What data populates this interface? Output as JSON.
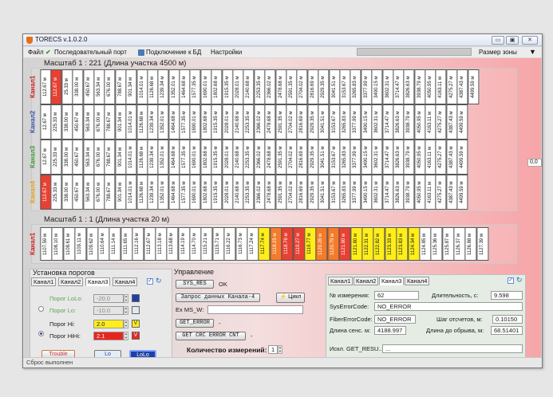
{
  "window": {
    "title": "TORECS v.1.0.2.0",
    "min": "▭",
    "max": "▣",
    "close": "✕"
  },
  "menu": {
    "file": "Файл",
    "serial": "Последовательный порт",
    "db": "Подключение к БД",
    "settings": "Настройки",
    "zone_label": "Размер зоны",
    "zone_arrow": "▼"
  },
  "icons": {
    "serial": "green-check-icon",
    "db": "database-icon",
    "app": "flame-icon"
  },
  "section1": {
    "title": "Масштаб 1 : 221 (Длина участка 4500 м)",
    "channels": [
      {
        "label": "Канал1",
        "color": "#cc1f1f",
        "cells": [
          "112.67 м",
          "112.67 м",
          "25.33 м",
          "338.00 м",
          "450.67 м",
          "563.34 м",
          "676.00 м",
          "788.67 м",
          "901.34 м",
          "1014.01 м",
          "1126.68 м",
          "1239.34 м",
          "1352.01 м",
          "1464.68 м",
          "1577.35 м",
          "1690.01 м",
          "1802.68 м",
          "1915.35 м",
          "2028.01 м",
          "2140.68 м",
          "2253.35 м",
          "2366.02 м",
          "2478.68 м",
          "2591.35 м",
          "2704.02 м",
          "2816.69 м",
          "2929.35 м",
          "3041.51 м",
          "3153.67 м",
          "3265.83 м",
          "3377.99 м",
          "3490.15 м",
          "3602.31 м",
          "3714.47 м",
          "3826.63 м",
          "3938.79 м",
          "4050.95 м",
          "4163.11 м",
          "4275.27 м",
          "4387.43 м",
          "4499.59 м"
        ],
        "highlight": [
          1
        ]
      },
      {
        "label": "Канал2",
        "color": "#3d55a8",
        "cells": [
          "12.67 м",
          "225.33 м",
          "338.00 м",
          "450.67 м",
          "563.34 м",
          "676.00 м",
          "788.67 м",
          "901.34 м",
          "1014.01 м",
          "1126.68 м",
          "1239.34 м",
          "1352.01 м",
          "1464.68 м",
          "1577.35 м",
          "1690.01 м",
          "1802.68 м",
          "1915.35 м",
          "2028.01 м",
          "2140.68 м",
          "2253.35 м",
          "2366.02 м",
          "2478.68 м",
          "2591.35 м",
          "2704.02 м",
          "2816.69 м",
          "2929.35 м",
          "3041.51 м",
          "3153.67 м",
          "3265.83 м",
          "3377.99 м",
          "3490.15 м",
          "3602.31 м",
          "3714.47 м",
          "3826.63 м",
          "3938.79 м",
          "4050.95 м",
          "4163.11 м",
          "4275.27 м",
          "4387.43 м",
          "4499.59 м"
        ],
        "highlight": []
      },
      {
        "label": "Канал3",
        "color": "#3f9a3a",
        "cells": [
          "12.67 м",
          "225.33 м",
          "338.00 м",
          "450.67 м",
          "563.34 м",
          "676.00 м",
          "788.67 м",
          "901.34 м",
          "1014.01 м",
          "1126.68 м",
          "1239.34 м",
          "1352.01 м",
          "1464.68 м",
          "1577.35 м",
          "1690.01 м",
          "1802.68 м",
          "1915.35 м",
          "2028.01 м",
          "2140.68 м",
          "2253.35 м",
          "2366.02 м",
          "2478.68 м",
          "2591.35 м",
          "2704.02 м",
          "2816.69 м",
          "2929.35 м",
          "3041.51 м",
          "3153.67 м",
          "3265.83 м",
          "3377.99 м",
          "3490.15 м",
          "3602.31 м",
          "3714.47 м",
          "3826.63 м",
          "3938.79 м",
          "4050.95 м",
          "4163.11 м",
          "4275.27 м",
          "4387.43 м",
          "4499.59 м"
        ],
        "highlight": []
      },
      {
        "label": "Канал4",
        "color": "#e0a020",
        "cells": [
          "112.67 м",
          "225.33 м",
          "338.00 м",
          "450.67 м",
          "563.34 м",
          "676.00 м",
          "788.67 м",
          "901.34 м",
          "1014.01 м",
          "1126.68 м",
          "1239.34 м",
          "1352.01 м",
          "1464.68 м",
          "1577.35 м",
          "1690.01 м",
          "1802.68 м",
          "1915.35 м",
          "2028.01 м",
          "2140.68 м",
          "2253.35 м",
          "2366.02 м",
          "2478.68 м",
          "2591.35 м",
          "2704.02 м",
          "2816.69 м",
          "2929.35 м",
          "3041.51 м",
          "3153.67 м",
          "3265.83 м",
          "3377.99 м",
          "3490.15 м",
          "3602.31 м",
          "3714.47 м",
          "3826.63 м",
          "3938.79 м",
          "4050.95 м",
          "4163.11 м",
          "4275.27 м",
          "4387.43 м",
          "4499.59 м"
        ],
        "highlight": [
          0
        ]
      }
    ]
  },
  "side_value": "0,0",
  "section2": {
    "title": "Масштаб 1 : 1 (Длина участка 20 м)",
    "channel": "Канал1",
    "cells": [
      "1107.59 м",
      "1108.10 м",
      "1108.61 м",
      "1109.11 м",
      "1109.62 м",
      "1110.64 м",
      "1111.14 м",
      "1111.65 м",
      "1112.16 м",
      "1112.67 м",
      "1113.18 м",
      "1113.68 м",
      "1114.19 м",
      "1114.70 м",
      "1115.21 м",
      "1115.71 м",
      "1116.22 м",
      "1116.73 м",
      "1117.24 м",
      "1117.74 м",
      "1118.25 м",
      "1118.76 м",
      "1119.27 м",
      "1119.77 м",
      "1120.28 м",
      "1120.79 м",
      "1121.80 м",
      "1121.80 м",
      "1122.31 м",
      "1122.82 м",
      "1123.33 м",
      "1123.83 м",
      "1124.34 м",
      "1124.85 м",
      "1125.36 м",
      "1125.87 м",
      "1126.37 м",
      "1126.88 м",
      "1127.39 м"
    ],
    "states": [
      "",
      "",
      "",
      "",
      "",
      "",
      "",
      "",
      "",
      "",
      "",
      "",
      "",
      "",
      "",
      "",
      "",
      "",
      "",
      "y",
      "o",
      "r",
      "r",
      "y",
      "o",
      "o",
      "r",
      "y",
      "y",
      "y",
      "y",
      "y",
      "y",
      "",
      "",
      "",
      "",
      "",
      ""
    ]
  },
  "thresholds": {
    "title": "Установка порогов",
    "tabs": [
      "Канал1",
      "Канал2",
      "Канал3",
      "Канал4"
    ],
    "active_tab": 2,
    "lolo_label": "Порог LoLo:",
    "lolo_value": "-20.0",
    "lo_label": "Порог Lo:",
    "lo_value": "-10.0",
    "hi_label": "Порог Hi:",
    "hi_value": "2.0",
    "hihi_label": "Порог HiHi:",
    "hihi_value": "2.1",
    "v_label": "V",
    "trouble_label": "Trouble",
    "lo_btn": "Lo",
    "lolo_btn": "LoLo",
    "colors": {
      "lolo": "#1f3fa8",
      "lo": "#dfe8f0",
      "hi": "#ffee1a",
      "hihi": "#e8261f",
      "trouble": "#e07a2a"
    }
  },
  "control": {
    "title": "Управление",
    "sys_res": "SYS_RES",
    "ok": "OK",
    "request": "Запрос данных Канала-4",
    "cycle": "Цикл",
    "exms": "Ex MS_W:",
    "get_error": "GET_ERROR",
    "dash": "-",
    "crc": "GET CRC ERROR CNT",
    "crc_dash": "-",
    "count_label": "Количество измерений:",
    "count_value": "1"
  },
  "info": {
    "tabs": [
      "Канал1",
      "Канал2",
      "Канал3",
      "Канал4"
    ],
    "active_tab": 2,
    "meas_no_label": "№ измерения:",
    "meas_no": "62",
    "duration_label": "Длительность, с:",
    "duration": "9.598",
    "syserr_label": "SysErrorCode:",
    "syserr": "NO_ERROR",
    "fibererr_label": "FiberErrorCode:",
    "fibererr": "NO_ERROR",
    "step_label": "Шаг отсчетов, м:",
    "step": "0.10150",
    "sens_label": "Длина сенс. м:",
    "sens": "4188.997",
    "break_label": "Длина до обрыва, м:",
    "break": "68.51401",
    "exc_label": "Искл. GET_RESU...",
    "exc": "..."
  },
  "status": "Сброс выполнен"
}
